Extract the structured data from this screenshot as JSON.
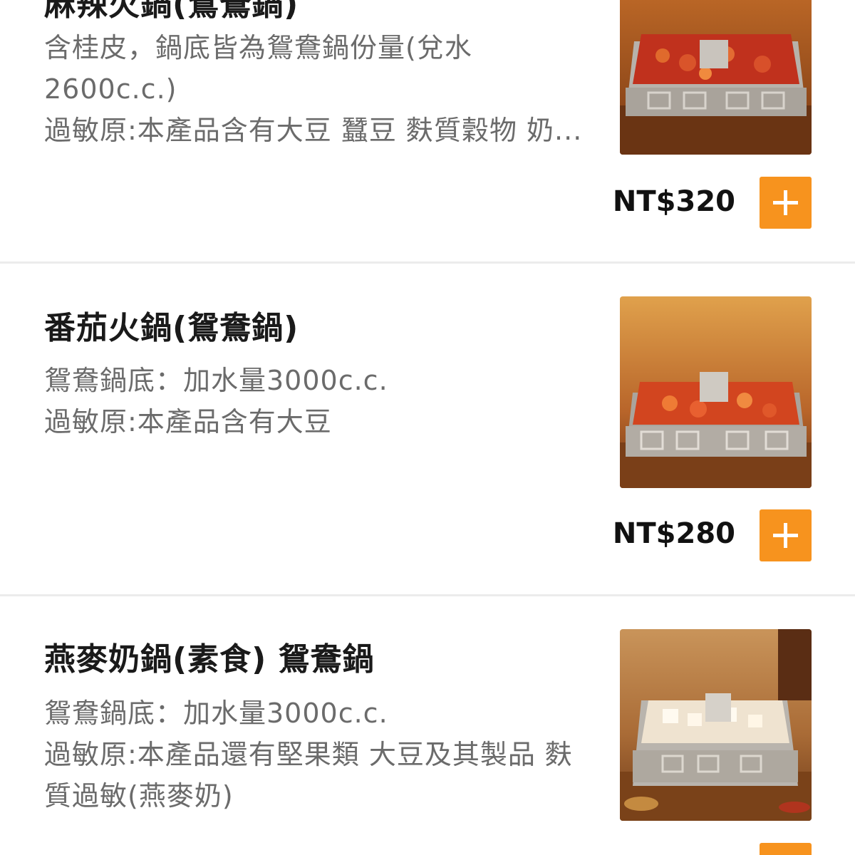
{
  "items": [
    {
      "title": "麻辣火鍋(鴛鴦鍋)",
      "desc": [
        "含桂皮，鍋底皆為鴛鴦鍋份量(兌水",
        "2600c.c.)",
        "過敏原:本產品含有大豆 蠶豆 麩質穀物 奶..."
      ],
      "price": "NT$320",
      "image": "spicy-hotpot-image"
    },
    {
      "title": "番茄火鍋(鴛鴦鍋)",
      "desc": [
        "鴛鴦鍋底：加水量3000c.c.",
        "過敏原:本產品含有大豆"
      ],
      "price": "NT$280",
      "image": "tomato-hotpot-image"
    },
    {
      "title": "燕麥奶鍋(素食) 鴛鴦鍋",
      "desc": [
        "鴛鴦鍋底：加水量3000c.c.",
        "過敏原:本產品還有堅果類 大豆及其製品 麩",
        "質過敏(燕麥奶)"
      ],
      "price": "",
      "image": "oat-milk-hotpot-image"
    }
  ],
  "colors": {
    "accent": "#f7931e",
    "title": "#1a1a1a",
    "desc": "#6b6b6b",
    "divider": "#ececec"
  },
  "icons": {
    "add": "plus-icon"
  }
}
